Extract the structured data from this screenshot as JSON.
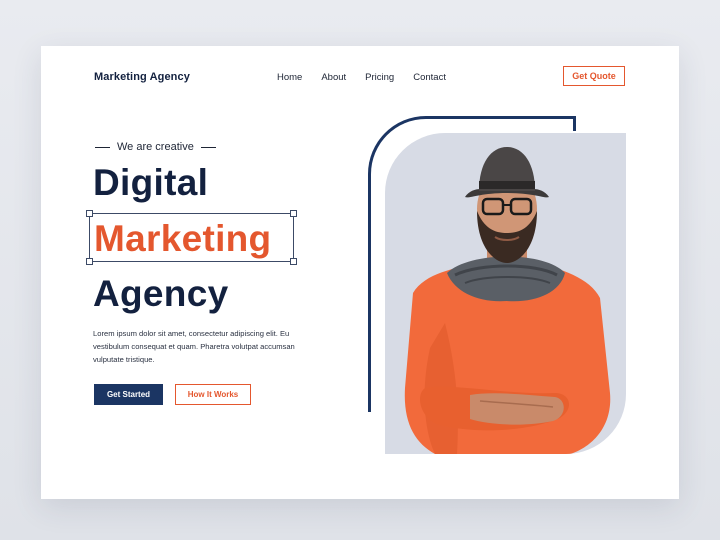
{
  "brand": {
    "logo": "Marketing Agency",
    "accent": "#e4572e",
    "navy": "#1b3563"
  },
  "nav": {
    "items": [
      "Home",
      "About",
      "Pricing",
      "Contact"
    ],
    "cta_label": "Get Quote"
  },
  "hero": {
    "tagline": "We are creative",
    "title_line1": "Digital",
    "title_line2": "Marketing",
    "title_line3": "Agency",
    "description": "Lorem ipsum dolor sit amet, consectetur adipiscing elit. Eu vestibulum consequat et quam. Pharetra volutpat accumsan vulputate tristique.",
    "primary_button": "Get Started",
    "secondary_button": "How It Works"
  },
  "image": {
    "icon": "person-portrait"
  }
}
